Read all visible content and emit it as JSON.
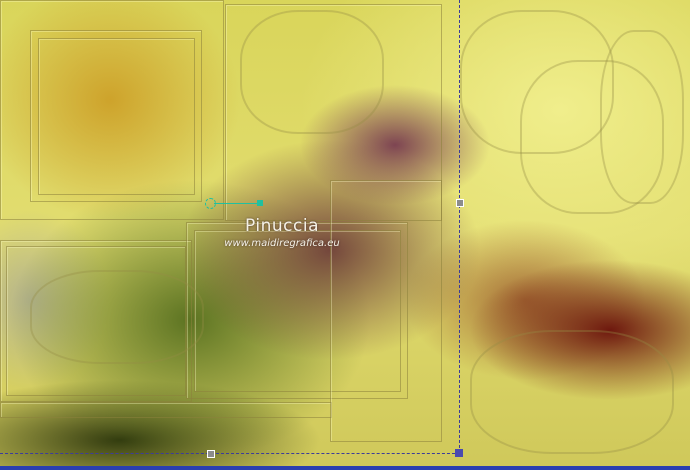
{
  "watermark": {
    "name": "Pinuccia",
    "url": "www.maidiregrafica.eu"
  },
  "colors": {
    "selection": "#3b3b9a",
    "rotation_handle": "#20c0a0",
    "bottom_bar": "#2a3fb0"
  },
  "icons": [
    "rotation-handle-icon",
    "resize-handle-icon"
  ]
}
